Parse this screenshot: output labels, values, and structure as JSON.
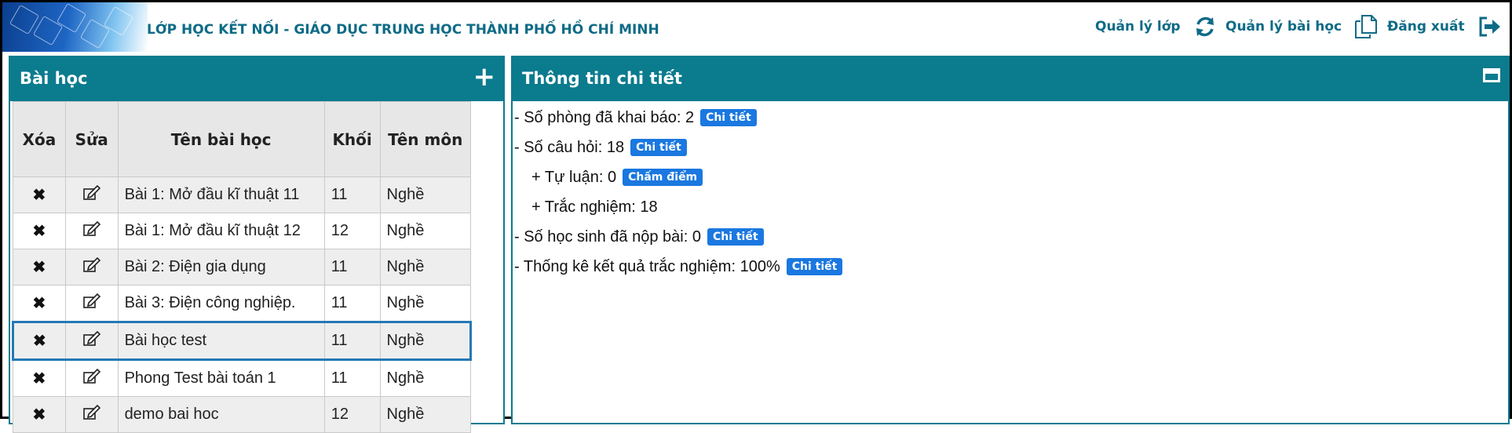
{
  "header": {
    "title": "LỚP HỌC KẾT NỐI -  GIÁO DỤC TRUNG HỌC THÀNH PHỐ HỒ CHÍ MINH",
    "nav": [
      {
        "label": "Quản lý lớp",
        "icon": "refresh-icon"
      },
      {
        "label": "Quản lý bài học",
        "icon": "copy-icon"
      },
      {
        "label": "Đăng xuất",
        "icon": "logout-icon"
      }
    ]
  },
  "lessons_panel": {
    "title": "Bài học",
    "columns": [
      "Xóa",
      "Sửa",
      "Tên bài học",
      "Khối",
      "Tên môn"
    ],
    "rows": [
      {
        "name": "Bài 1: Mở đầu kĩ thuật 11",
        "grade": "11",
        "subject": "Nghề"
      },
      {
        "name": "Bài 1: Mở đầu kĩ thuật 12",
        "grade": "12",
        "subject": "Nghề"
      },
      {
        "name": "Bài 2: Điện gia dụng",
        "grade": "11",
        "subject": "Nghề"
      },
      {
        "name": "Bài 3: Điện công nghiệp.",
        "grade": "11",
        "subject": "Nghề"
      },
      {
        "name": "Bài học test",
        "grade": "11",
        "subject": "Nghề"
      },
      {
        "name": "Phong Test bài toán 1",
        "grade": "11",
        "subject": "Nghề"
      },
      {
        "name": "demo bai hoc",
        "grade": "12",
        "subject": "Nghề"
      }
    ]
  },
  "detail_panel": {
    "title": "Thông tin chi tiết",
    "lines": [
      {
        "text": "- Số phòng đã khai báo: 2",
        "badge": "Chi tiết"
      },
      {
        "text": "- Số câu hỏi: 18",
        "badge": "Chi tiết"
      },
      {
        "text": "+ Tự luận: 0",
        "badge": "Chấm điểm"
      },
      {
        "text": "+ Trắc nghiệm: 18",
        "badge": ""
      },
      {
        "text": "- Số học sinh đã nộp bài: 0",
        "badge": "Chi tiết"
      },
      {
        "text": "- Thống kê kết quả trắc nghiệm: 100%",
        "badge": "Chi tiết"
      }
    ]
  },
  "colors": {
    "accent": "#0b7b8e",
    "badge": "#1a78e0",
    "selected_border": "#2478b6"
  }
}
